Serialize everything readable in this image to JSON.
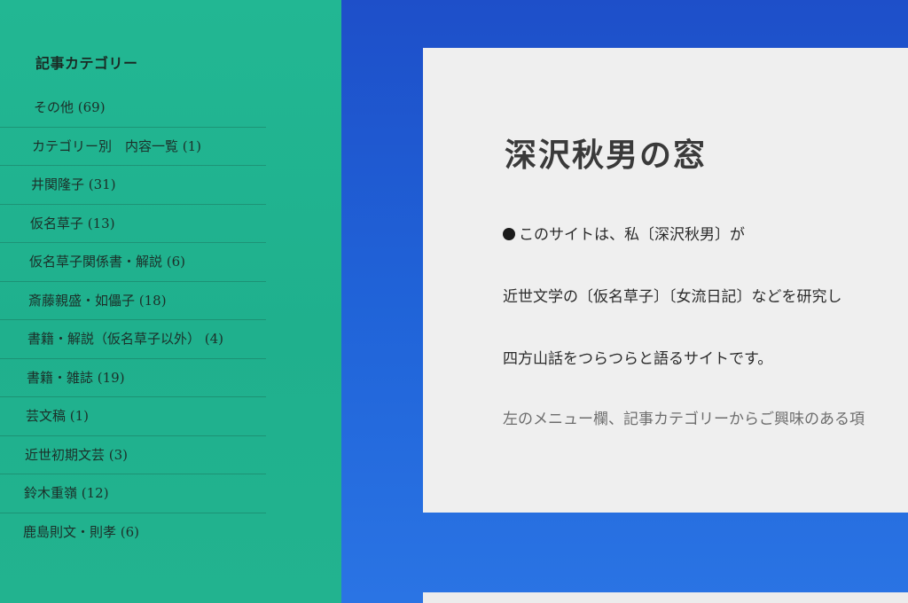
{
  "sidebar": {
    "title": "記事カテゴリー",
    "categories": [
      {
        "label": "その他 (69)"
      },
      {
        "label": "カテゴリー別　内容一覧 (1)"
      },
      {
        "label": "井関隆子 (31)"
      },
      {
        "label": "仮名草子 (13)"
      },
      {
        "label": "仮名草子関係書・解説 (6)"
      },
      {
        "label": "斎藤親盛・如儡子 (18)"
      },
      {
        "label": "書籍・解説（仮名草子以外） (4)"
      },
      {
        "label": "書籍・雑誌 (19)"
      },
      {
        "label": "芸文稿 (1)"
      },
      {
        "label": "近世初期文芸 (3)"
      },
      {
        "label": "鈴木重嶺 (12)"
      },
      {
        "label": "鹿島則文・則孝 (6)"
      }
    ]
  },
  "main": {
    "title": "深沢秋男の窓",
    "paragraphs": [
      "このサイトは、私〔深沢秋男〕が",
      "近世文学の〔仮名草子〕〔女流日記〕などを研究し",
      "四方山話をつらつらと語るサイトです。",
      "左のメニュー欄、記事カテゴリーからご興味のある項"
    ]
  }
}
